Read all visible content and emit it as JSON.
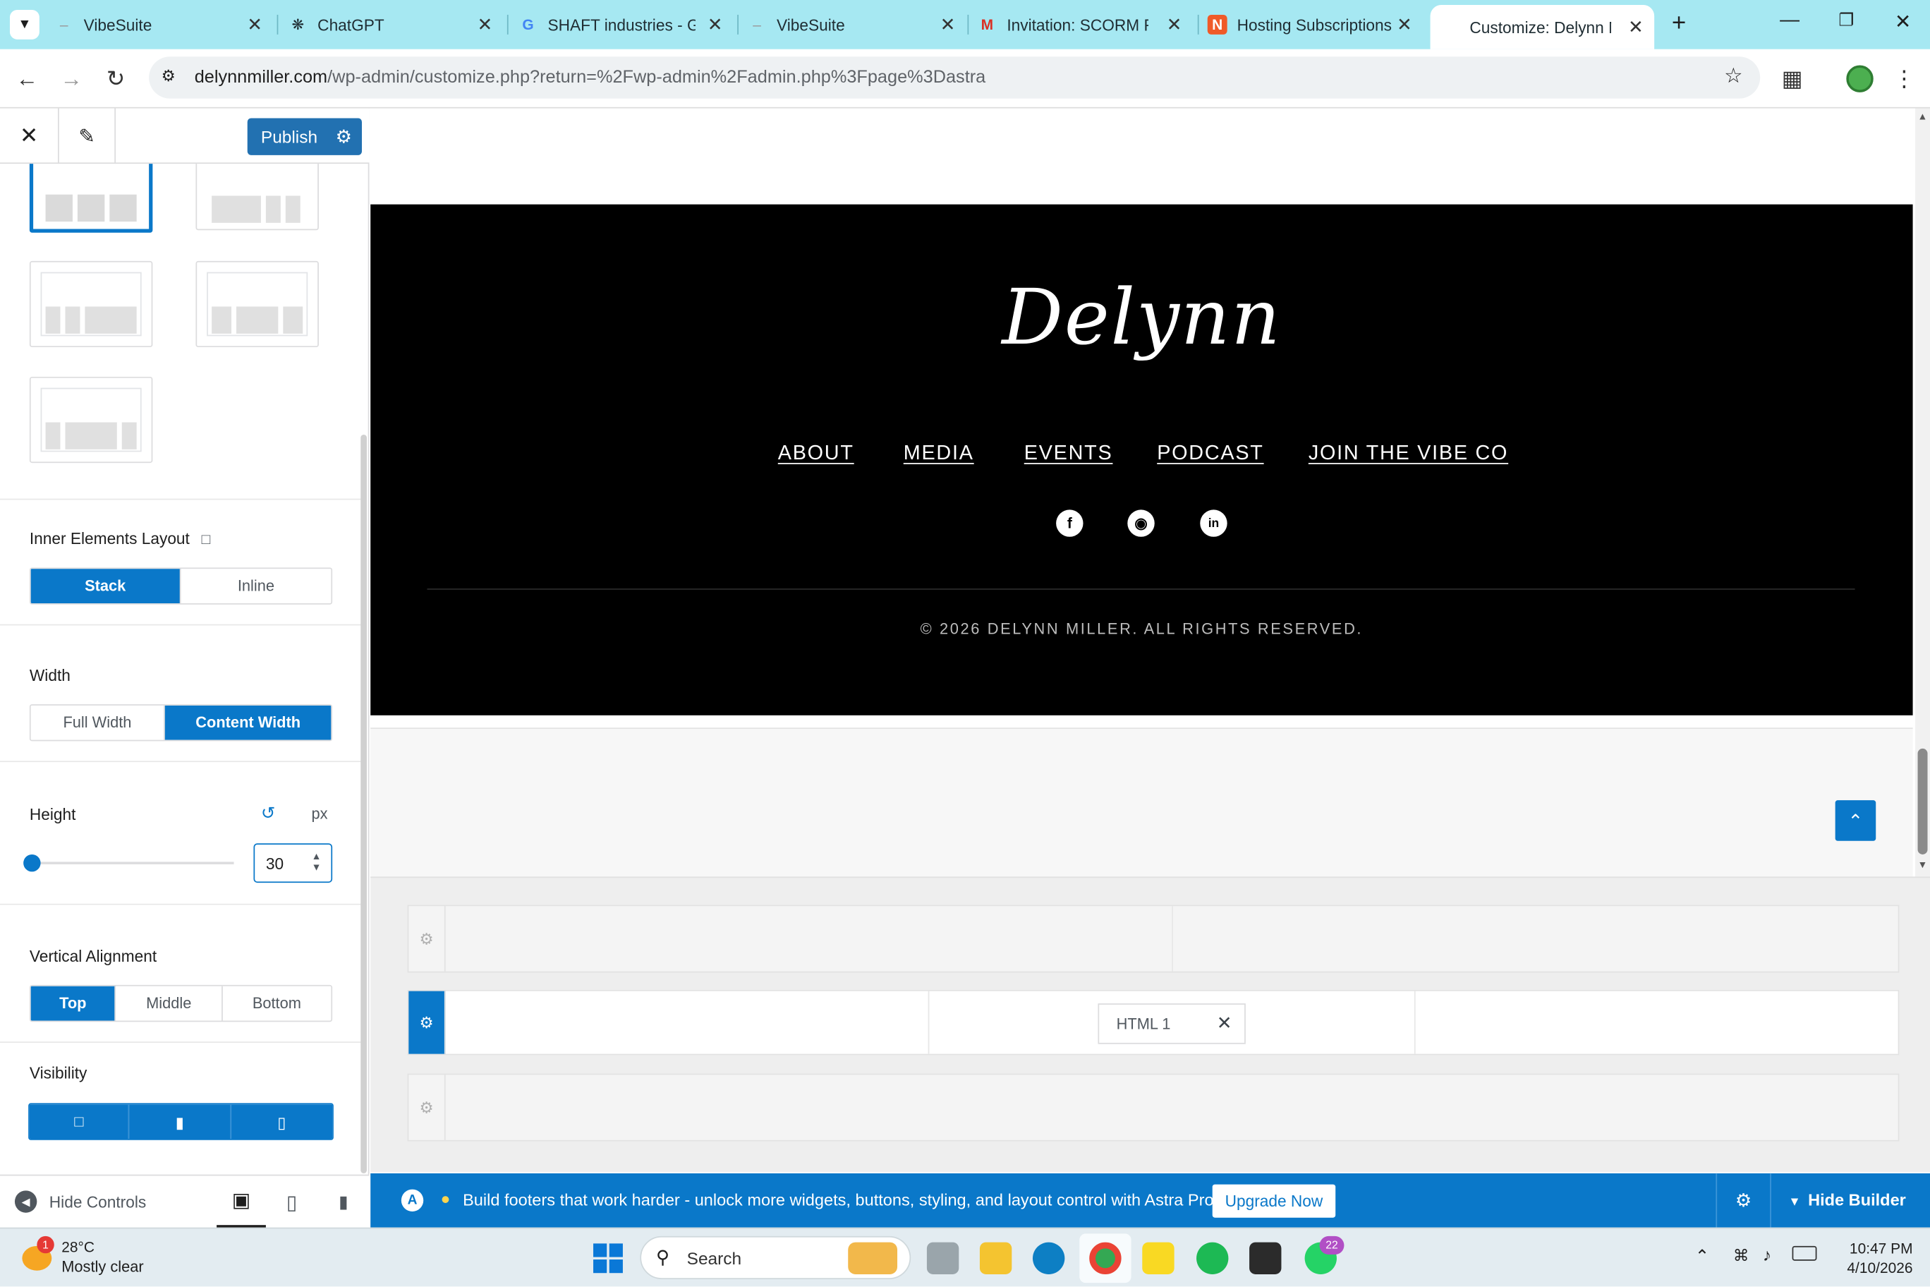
{
  "browser": {
    "tabs": [
      {
        "title": "VibeSuite",
        "icon": "vibesuite-favicon"
      },
      {
        "title": "ChatGPT",
        "icon": "chatgpt-favicon"
      },
      {
        "title": "SHAFT industries - Go",
        "icon": "google-favicon"
      },
      {
        "title": "VibeSuite",
        "icon": "vibesuite-favicon"
      },
      {
        "title": "Invitation: SCORM Re",
        "icon": "gmail-favicon"
      },
      {
        "title": "Hosting Subscriptions",
        "icon": "hosting-favicon"
      },
      {
        "title": "Customize: Delynn M",
        "icon": "none",
        "active": true
      }
    ],
    "url_domain": "delynnmiller.com",
    "url_path": "/wp-admin/customize.php?return=%2Fwp-admin%2Fadmin.php%3Fpage%3Dastra"
  },
  "customizer": {
    "publish_label": "Publish",
    "inner_elements_layout": {
      "label": "Inner Elements Layout",
      "options": [
        "Stack",
        "Inline"
      ],
      "selected": "Stack"
    },
    "width": {
      "label": "Width",
      "options": [
        "Full Width",
        "Content Width"
      ],
      "selected": "Content Width"
    },
    "height": {
      "label": "Height",
      "unit": "px",
      "value": "30"
    },
    "vertical_alignment": {
      "label": "Vertical Alignment",
      "options": [
        "Top",
        "Middle",
        "Bottom"
      ],
      "selected": "Top"
    },
    "visibility": {
      "label": "Visibility"
    },
    "hide_controls_label": "Hide Controls"
  },
  "preview": {
    "logo_text": "Delynn",
    "nav": [
      "ABOUT",
      "MEDIA",
      "EVENTS",
      "PODCAST",
      "JOIN THE VIBE CO"
    ],
    "social": [
      "facebook-icon",
      "instagram-icon",
      "linkedin-icon"
    ],
    "copyright": "© 2026 DELYNN MILLER. ALL RIGHTS RESERVED."
  },
  "builder": {
    "html_widget_label": "HTML 1"
  },
  "notice": {
    "text": "Build footers that work harder - unlock more widgets, buttons, styling, and layout control with Astra Pro",
    "upgrade_label": "Upgrade Now",
    "hide_builder_label": "Hide Builder"
  },
  "taskbar": {
    "weather_temp": "28°C",
    "weather_desc": "Mostly clear",
    "weather_badge": "1",
    "search_label": "Search",
    "whatsapp_badge": "22",
    "time": "10:47 PM",
    "date": "4/10/2026"
  },
  "colors": {
    "accent": "#0a78c9",
    "tabstrip": "#a6e8f2",
    "publish": "#2271b1"
  }
}
